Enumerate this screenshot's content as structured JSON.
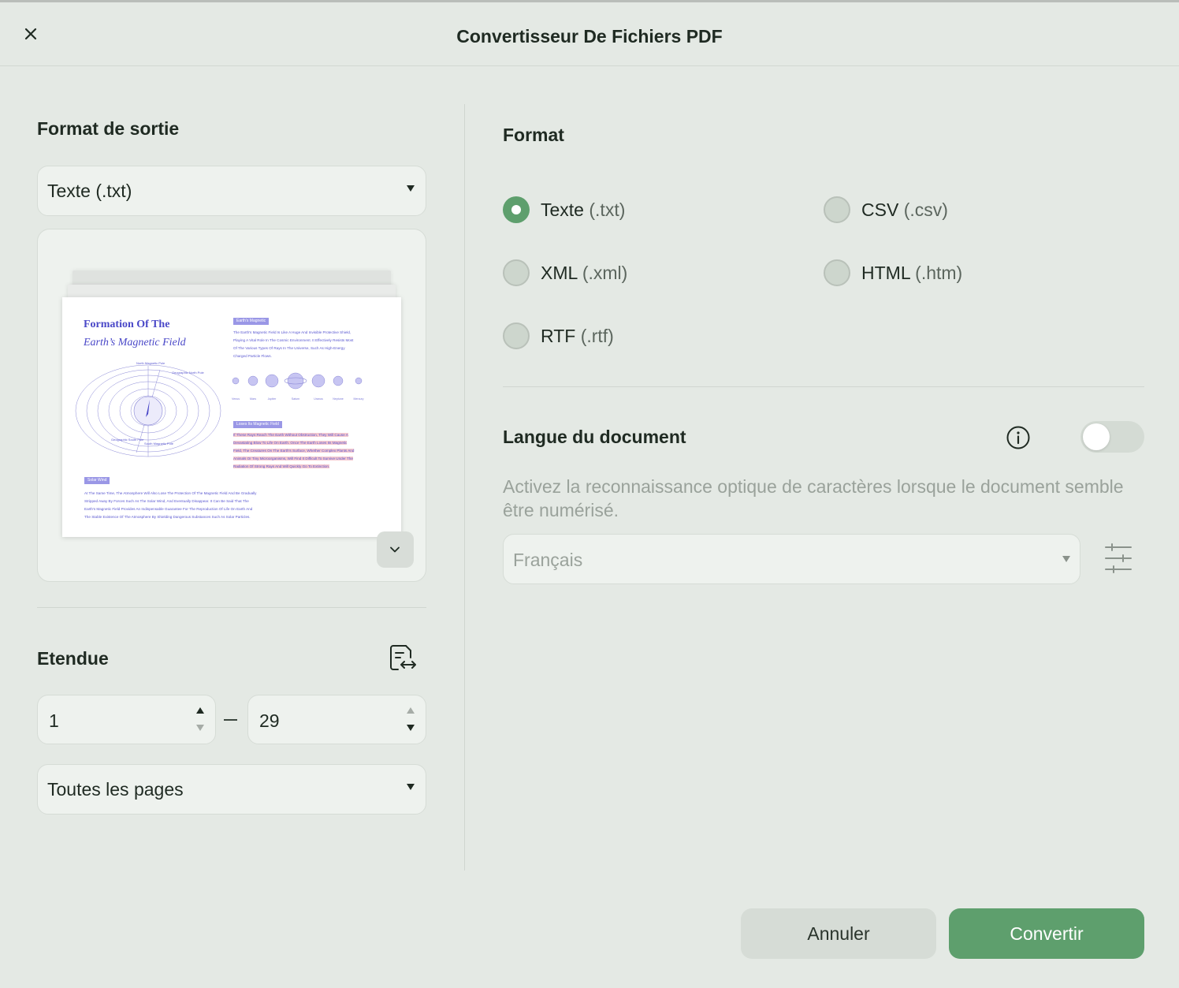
{
  "window": {
    "title": "Convertisseur De Fichiers PDF"
  },
  "output": {
    "section_title": "Format de sortie",
    "selected_format": "Texte (.txt)"
  },
  "preview": {
    "title_line1": "Formation Of The",
    "title_line2": "Earth’s Magnetic Field",
    "tag1": "Earth's Magnetic",
    "para1": [
      "The Earth's Magnetic Field Is Like A Huge And Invisible Protective Shield,",
      "Playing A Vital Role In The Cosmic Environment. It Effectively Resists Most",
      "Of The Various Types Of Rays In The Universe, Such As High-Energy",
      "Charged Particle Flows."
    ],
    "tag2": "Loses Its Magnetic Field",
    "para2": [
      "If These Rays Reach The Earth Without Obstruction, They Will Cause A",
      "Devastating Blow To Life On Earth. Once The Earth Loses Its Magnetic",
      "Field, The Creatures On The Earth's Surface, Whether Complex Plants And",
      "Animals Or Tiny Microorganisms, Will Find It Difficult To Survive Under The",
      "Radiation Of Strong Rays And Will Quickly Go To Extinction."
    ],
    "tag3": "Solar Wind",
    "para3": [
      "At The Same Time, The Atmosphere Will Also Lose The Protection Of The Magnetic Field And Be Gradually",
      "Stripped Away By Forces Such As The Solar Wind, And Eventually Disappear. It Can Be Said That The",
      "Earth's Magnetic Field Provides An Indispensable Guarantee For The Reproduction Of Life On Earth And",
      "The Stable Existence Of The Atmosphere By Shielding Dangerous Substances Such As Solar Particles."
    ],
    "diagram_labels": {
      "north_magnetic": "North Magnetic Pole",
      "geographic_north": "Geographic North Pole",
      "geographic_south": "Geographic South Pole",
      "south_magnetic": "South Magnetic Pole"
    },
    "planets": [
      "Venus",
      "Mars",
      "Jupiter",
      "Saturn",
      "Uranus",
      "Neptune",
      "Mercury"
    ]
  },
  "range": {
    "section_title": "Etendue",
    "from": "1",
    "to": "29",
    "pages_option": "Toutes les pages"
  },
  "format": {
    "section_title": "Format",
    "options": [
      {
        "name": "Texte",
        "ext": "(.txt)",
        "selected": true
      },
      {
        "name": "CSV",
        "ext": "(.csv)",
        "selected": false
      },
      {
        "name": "XML",
        "ext": "(.xml)",
        "selected": false
      },
      {
        "name": "HTML",
        "ext": "(.htm)",
        "selected": false
      },
      {
        "name": "RTF",
        "ext": "(.rtf)",
        "selected": false
      }
    ]
  },
  "language": {
    "section_title": "Langue du document",
    "ocr_enabled": false,
    "description": "Activez la reconnaissance optique de caractères lorsque le document semble être numérisé.",
    "selected": "Français"
  },
  "buttons": {
    "cancel": "Annuler",
    "convert": "Convertir"
  },
  "colors": {
    "accent": "#5e9f6d",
    "background": "#e4e9e4",
    "field": "#eef2ee",
    "preview_text": "#4a48c8"
  },
  "icons": {
    "close": "close-icon",
    "expand": "chevron-down-icon",
    "range_swap": "document-swap-icon",
    "info": "info-icon",
    "settings": "sliders-icon"
  }
}
